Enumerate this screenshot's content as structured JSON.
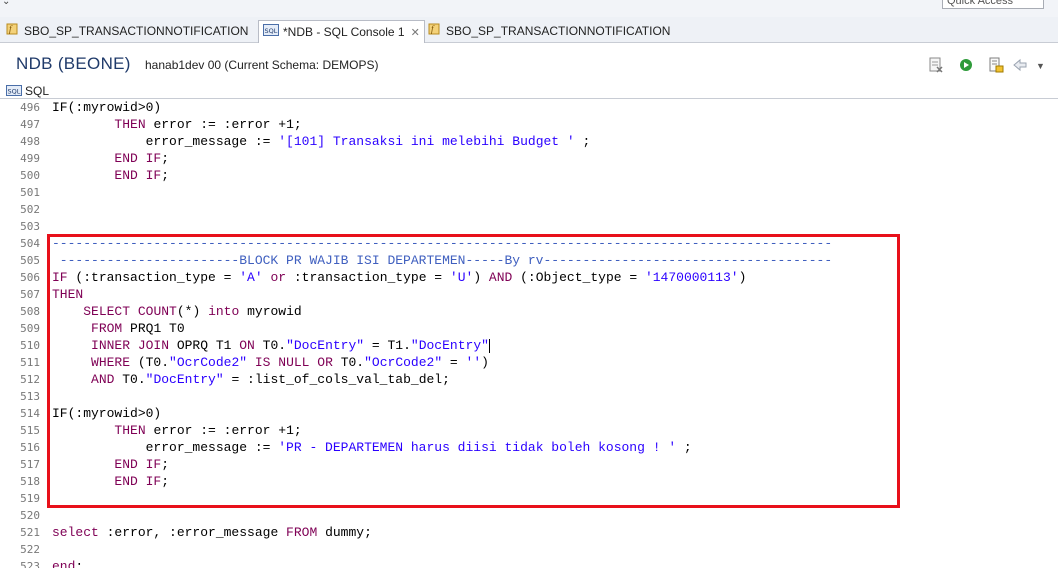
{
  "topbar": {
    "quick_access": "Quick Access"
  },
  "tabs": [
    {
      "label": "SBO_SP_TRANSACTIONNOTIFICATION",
      "active": false,
      "icon": "procedure-icon"
    },
    {
      "label": "*NDB - SQL Console 1",
      "active": true,
      "icon": "sql-console-icon",
      "close": "✕"
    },
    {
      "label": "SBO_SP_TRANSACTIONNOTIFICATION",
      "active": false,
      "icon": "procedure-icon"
    }
  ],
  "connection": {
    "title": "NDB (BEONE)",
    "info": "hanab1dev 00 (Current Schema: DEMOPS)"
  },
  "subtab": {
    "label": "SQL",
    "icon": "sql-icon"
  },
  "colors": {
    "keyword": "#7f0055",
    "string": "#2a00ff",
    "comment": "#3f5fbf",
    "highlight": "#e8101a"
  },
  "editor": {
    "lines": [
      {
        "n": "496",
        "segs": [
          [
            "IF(:myrowid>0)",
            ""
          ]
        ]
      },
      {
        "n": "497",
        "segs": [
          [
            "        ",
            ""
          ],
          [
            "THEN",
            "kw"
          ],
          [
            " error := :error +1;",
            ""
          ]
        ]
      },
      {
        "n": "498",
        "segs": [
          [
            "            error_message := ",
            ""
          ],
          [
            "'[101] Transaksi ini melebihi Budget '",
            "str"
          ],
          [
            " ;",
            ""
          ]
        ]
      },
      {
        "n": "499",
        "segs": [
          [
            "        ",
            ""
          ],
          [
            "END IF",
            "kw"
          ],
          [
            ";",
            ""
          ]
        ]
      },
      {
        "n": "500",
        "segs": [
          [
            "        ",
            ""
          ],
          [
            "END IF",
            "kw"
          ],
          [
            ";",
            ""
          ]
        ]
      },
      {
        "n": "501",
        "segs": []
      },
      {
        "n": "502",
        "segs": []
      },
      {
        "n": "503",
        "segs": []
      },
      {
        "n": "504",
        "segs": [
          [
            "----------------------------------------------------------------------------------------------------",
            "cmt"
          ]
        ]
      },
      {
        "n": "505",
        "segs": [
          [
            " -----------------------BLOCK PR WAJIB ISI DEPARTEMEN-----By rv-------------------------------------",
            "cmt"
          ]
        ]
      },
      {
        "n": "506",
        "segs": [
          [
            "IF",
            "kw"
          ],
          [
            " (:transaction_type = ",
            ""
          ],
          [
            "'A'",
            "str"
          ],
          [
            " ",
            ""
          ],
          [
            "or",
            "kw"
          ],
          [
            " :transaction_type = ",
            ""
          ],
          [
            "'U'",
            "str"
          ],
          [
            ") ",
            ""
          ],
          [
            "AND",
            "kw"
          ],
          [
            " (:Object_type = ",
            ""
          ],
          [
            "'1470000113'",
            "str"
          ],
          [
            ")",
            ""
          ]
        ]
      },
      {
        "n": "507",
        "segs": [
          [
            "THEN",
            "kw"
          ]
        ]
      },
      {
        "n": "508",
        "segs": [
          [
            "    ",
            ""
          ],
          [
            "SELECT",
            "kw"
          ],
          [
            " ",
            ""
          ],
          [
            "COUNT",
            "kw"
          ],
          [
            "(*) ",
            ""
          ],
          [
            "into",
            "kw"
          ],
          [
            " myrowid",
            ""
          ]
        ]
      },
      {
        "n": "509",
        "segs": [
          [
            "     ",
            ""
          ],
          [
            "FROM",
            "kw"
          ],
          [
            " PRQ1 T0",
            ""
          ]
        ]
      },
      {
        "n": "510",
        "segs": [
          [
            "     ",
            ""
          ],
          [
            "INNER JOIN",
            "kw"
          ],
          [
            " OPRQ T1 ",
            ""
          ],
          [
            "ON",
            "kw"
          ],
          [
            " T0.",
            ""
          ],
          [
            "\"DocEntry\"",
            "str"
          ],
          [
            " = T1.",
            ""
          ],
          [
            "\"DocEntry\"",
            "str"
          ],
          [
            "|",
            "cursor"
          ]
        ]
      },
      {
        "n": "511",
        "segs": [
          [
            "     ",
            ""
          ],
          [
            "WHERE",
            "kw"
          ],
          [
            " (T0.",
            ""
          ],
          [
            "\"OcrCode2\"",
            "str"
          ],
          [
            " ",
            ""
          ],
          [
            "IS NULL OR",
            "kw"
          ],
          [
            " T0.",
            ""
          ],
          [
            "\"OcrCode2\"",
            "str"
          ],
          [
            " = ",
            ""
          ],
          [
            "''",
            "str"
          ],
          [
            ")",
            ""
          ]
        ]
      },
      {
        "n": "512",
        "segs": [
          [
            "     ",
            ""
          ],
          [
            "AND",
            "kw"
          ],
          [
            " T0.",
            ""
          ],
          [
            "\"DocEntry\"",
            "str"
          ],
          [
            " = :list_of_cols_val_tab_del;",
            ""
          ]
        ]
      },
      {
        "n": "513",
        "segs": []
      },
      {
        "n": "514",
        "segs": [
          [
            "IF(:myrowid>0)",
            ""
          ]
        ]
      },
      {
        "n": "515",
        "segs": [
          [
            "        ",
            ""
          ],
          [
            "THEN",
            "kw"
          ],
          [
            " error := :error +1;",
            ""
          ]
        ]
      },
      {
        "n": "516",
        "segs": [
          [
            "            error_message := ",
            ""
          ],
          [
            "'PR - DEPARTEMEN harus diisi tidak boleh kosong ! '",
            "str"
          ],
          [
            " ;",
            ""
          ]
        ]
      },
      {
        "n": "517",
        "segs": [
          [
            "        ",
            ""
          ],
          [
            "END IF",
            "kw"
          ],
          [
            ";",
            ""
          ]
        ]
      },
      {
        "n": "518",
        "segs": [
          [
            "        ",
            ""
          ],
          [
            "END IF",
            "kw"
          ],
          [
            ";",
            ""
          ]
        ]
      },
      {
        "n": "519",
        "segs": []
      },
      {
        "n": "520",
        "segs": []
      },
      {
        "n": "521",
        "segs": [
          [
            "select",
            "kw"
          ],
          [
            " :error, :error_message ",
            ""
          ],
          [
            "FROM",
            "kw"
          ],
          [
            " dummy;",
            ""
          ]
        ]
      },
      {
        "n": "522",
        "segs": []
      },
      {
        "n": "523",
        "segs": [
          [
            "end",
            "kw"
          ],
          [
            ";",
            ""
          ]
        ]
      }
    ]
  }
}
